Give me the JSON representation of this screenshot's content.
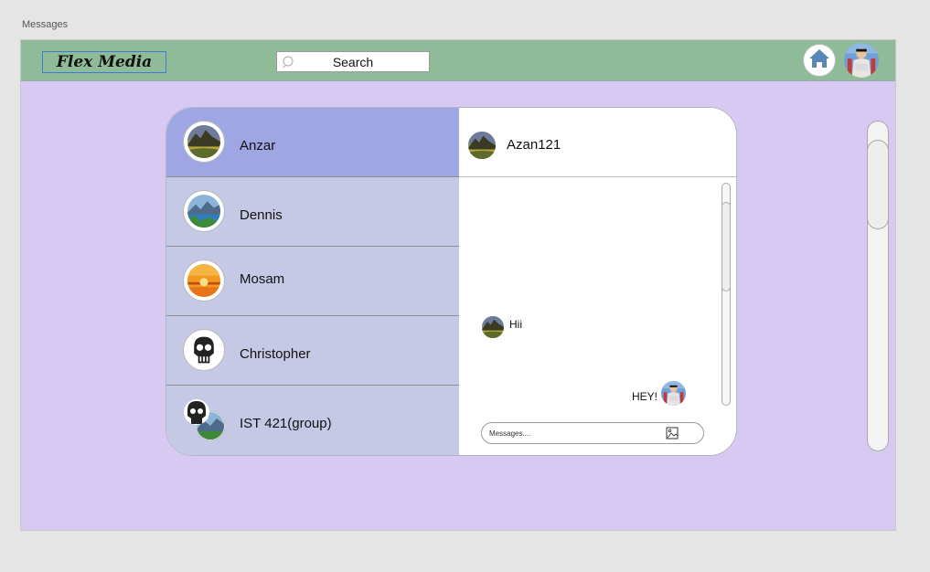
{
  "page_label": "Messages",
  "header": {
    "logo": "Flex Media",
    "search_label": "Search",
    "icons": {
      "search": "search-icon",
      "home": "home-icon"
    }
  },
  "contacts": [
    {
      "name": "Anzar",
      "active": true,
      "avatar": "landscape-avatar"
    },
    {
      "name": "Dennis",
      "active": false,
      "avatar": "mountain-lake-avatar"
    },
    {
      "name": "Mosam",
      "active": false,
      "avatar": "sunset-avatar"
    },
    {
      "name": "Christopher",
      "active": false,
      "avatar": "skull-avatar"
    },
    {
      "name": "IST 421(group)",
      "active": false,
      "avatar": "group-avatar"
    }
  ],
  "chat": {
    "title": "Azan121",
    "messages": [
      {
        "text": "Hii",
        "direction": "incoming"
      },
      {
        "text": "HEY!",
        "direction": "outgoing"
      }
    ],
    "input_placeholder": "Messages....",
    "attach_icon": "image-icon"
  },
  "colors": {
    "topbar": "#8fbb98",
    "background": "#d8c9f3",
    "contact": "#c5c9e6",
    "contact_active": "#9ea7e3"
  }
}
